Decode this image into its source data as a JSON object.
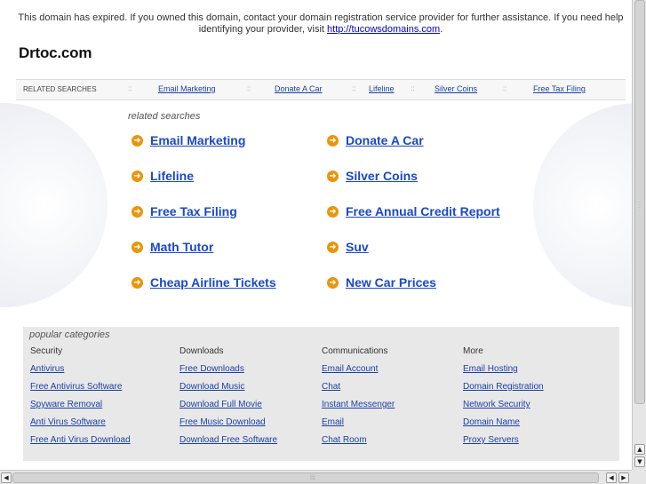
{
  "notice": {
    "text_before": "This domain has expired. If you owned this domain, contact your domain registration service provider for further assistance. If you need help identifying your provider, visit ",
    "link": "http://tucowsdomains.com",
    "text_after": "."
  },
  "domain_title": "Drtoc.com",
  "related_bar": {
    "label": "RELATED SEARCHES",
    "separator": "::",
    "links": [
      "Email Marketing",
      "Donate A Car",
      "Lifeline",
      "Silver Coins",
      "Free Tax Filing"
    ]
  },
  "related_searches": {
    "heading": "related searches",
    "arrow_icon": "➜",
    "items": [
      "Email Marketing",
      "Donate A Car",
      "Lifeline",
      "Silver Coins",
      "Free Tax Filing",
      "Free Annual Credit Report",
      "Math Tutor",
      "Suv",
      "Cheap Airline Tickets",
      "New Car Prices"
    ]
  },
  "popular": {
    "heading": "popular categories",
    "columns": [
      {
        "title": "Security",
        "links": [
          "Antivirus",
          "Free Antivirus Software",
          "Spyware Removal",
          "Anti Virus Software",
          "Free Anti Virus Download"
        ]
      },
      {
        "title": "Downloads",
        "links": [
          "Free Downloads",
          "Download Music",
          "Download Full Movie",
          "Free Music Download",
          "Download Free Software"
        ]
      },
      {
        "title": "Communications",
        "links": [
          "Email Account",
          "Chat",
          "Instant Messenger",
          "Email",
          "Chat Room"
        ]
      },
      {
        "title": "More",
        "links": [
          "Email Hosting",
          "Domain Registration",
          "Network Security",
          "Domain Name",
          "Proxy Servers"
        ]
      }
    ]
  },
  "colors": {
    "link": "#1a48c7",
    "arrow": "#e8960e",
    "popular_bg": "#e8e8e8"
  }
}
